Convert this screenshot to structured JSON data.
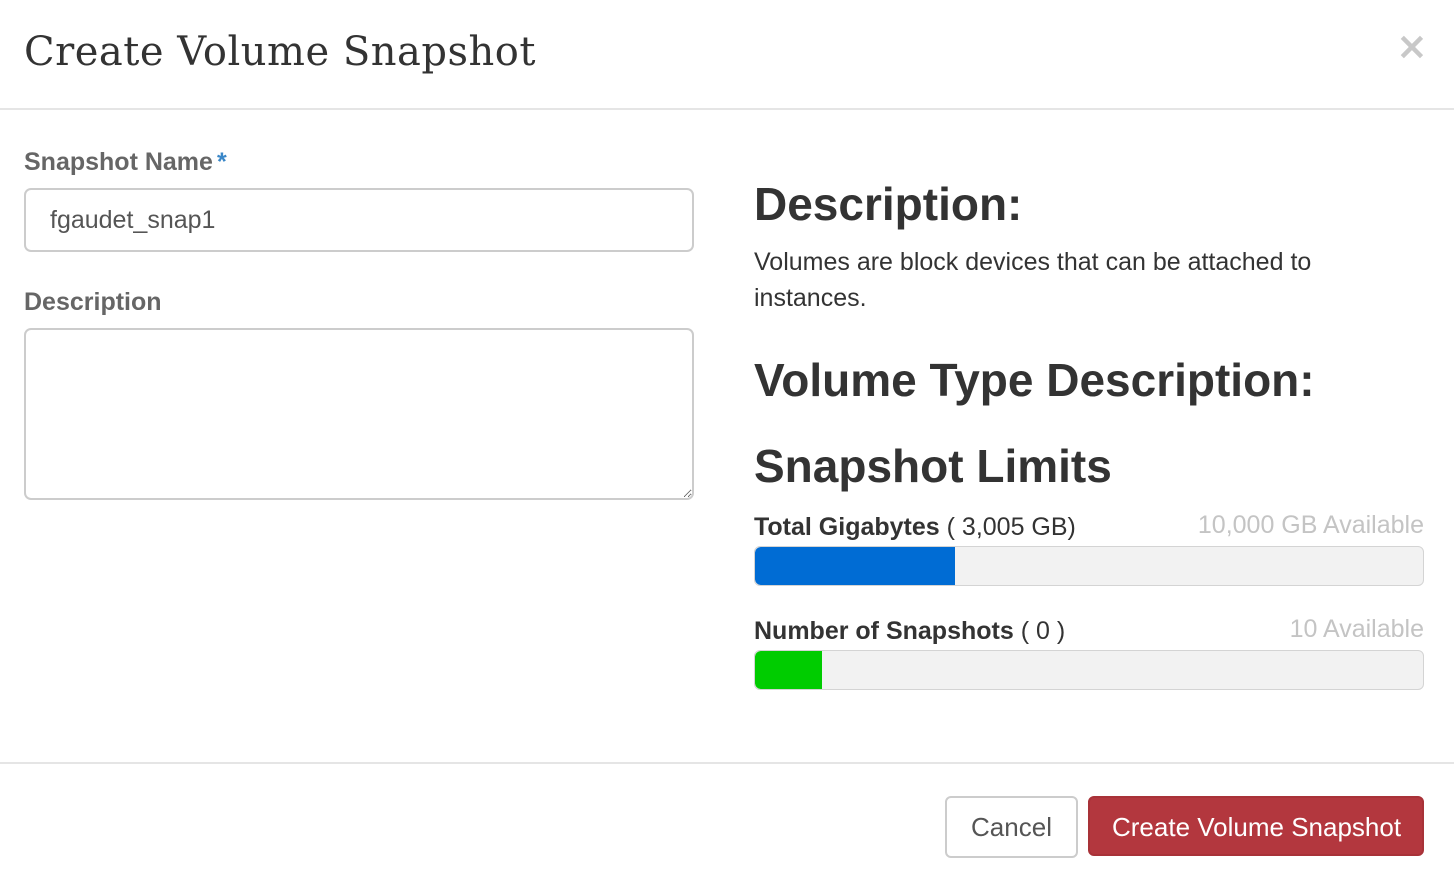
{
  "dialog": {
    "title": "Create Volume Snapshot",
    "close_glyph": "×"
  },
  "form": {
    "snapshot_name": {
      "label": "Snapshot Name",
      "required_marker": "*",
      "value": "fgaudet_snap1"
    },
    "description": {
      "label": "Description",
      "value": ""
    }
  },
  "help": {
    "description_heading": "Description:",
    "description_text": "Volumes are block devices that can be attached to instances.",
    "volume_type_heading": "Volume Type Description:",
    "limits_heading": "Snapshot Limits"
  },
  "limits": [
    {
      "label": "Total Gigabytes",
      "used": "( 3,005 GB)",
      "available": "10,000 GB Available",
      "fill_fraction": 0.3,
      "color": "#006cd4"
    },
    {
      "label": "Number of Snapshots",
      "used": "( 0 )",
      "available": "10 Available",
      "fill_fraction": 0.1,
      "color": "#00cc00"
    }
  ],
  "footer": {
    "cancel_label": "Cancel",
    "submit_label": "Create Volume Snapshot"
  }
}
